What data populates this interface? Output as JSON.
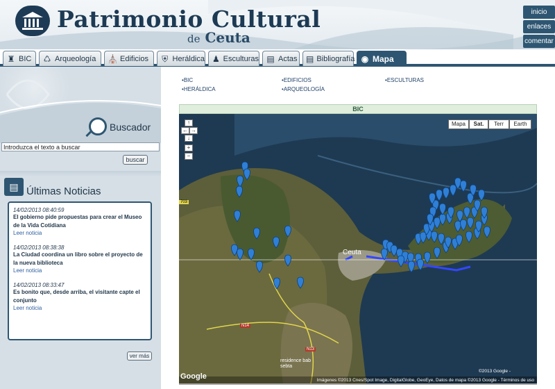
{
  "header": {
    "title": "Patrimonio Cultural",
    "subtitle_de": "de",
    "subtitle_place": "Ceuta",
    "buttons": [
      "inicio",
      "enlaces",
      "comentar"
    ]
  },
  "tabs": [
    {
      "label": "BIC",
      "icon": "tower-icon"
    },
    {
      "label": "Arqueología",
      "icon": "amphora-icon"
    },
    {
      "label": "Edificios",
      "icon": "building-icon"
    },
    {
      "label": "Heráldica",
      "icon": "shield-icon"
    },
    {
      "label": "Esculturas",
      "icon": "statue-icon"
    },
    {
      "label": "Actas",
      "icon": "document-icon"
    },
    {
      "label": "Bibliografía",
      "icon": "book-icon"
    },
    {
      "label": "Mapa",
      "icon": "eye-icon",
      "active": true
    }
  ],
  "search": {
    "label": "Buscador",
    "value": "Introduzca el texto a buscar",
    "button": "buscar"
  },
  "news": {
    "title": "Últimas Noticias",
    "items": [
      {
        "date": "14/02/2013 08:40:59",
        "headline": "El gobierno pide propuestas para crear el Museo de la Vida Cotidiana",
        "link": "Leer noticia"
      },
      {
        "date": "14/02/2013 08:38:38",
        "headline": "La Ciudad coordina un libro sobre el proyecto de la nueva biblioteca",
        "link": "Leer noticia"
      },
      {
        "date": "14/02/2013 08:33:47",
        "headline": "Es bonito que, desde arriba, el visitante capte el conjunto",
        "link": "Leer noticia"
      }
    ],
    "more": "ver más"
  },
  "categories": [
    "BIC",
    "EDIFICIOS",
    "ESCULTURAS",
    "HERÁLDICA",
    "ARQUEOLOGÍA"
  ],
  "map": {
    "section_title": "BIC",
    "types": [
      "Mapa",
      "Sat.",
      "Terr",
      "Earth"
    ],
    "selected_type": "Sat.",
    "city_label": "Ceuta",
    "label_residence": "residence bab sebta",
    "label_n13": "N13",
    "label_n14": "N14",
    "label_703": "703",
    "copyright": "©2013 Google -",
    "attribution": "Imágenes ©2013 Cnes/Spot Image, DigitalGlobe, GeoEye, Datos de mapa ©2013 Google - Términos de uso",
    "logo": "Google",
    "colors": {
      "accent": "#2e5672",
      "marker": "#2f7fd6",
      "sea": "#1e3a52"
    }
  }
}
